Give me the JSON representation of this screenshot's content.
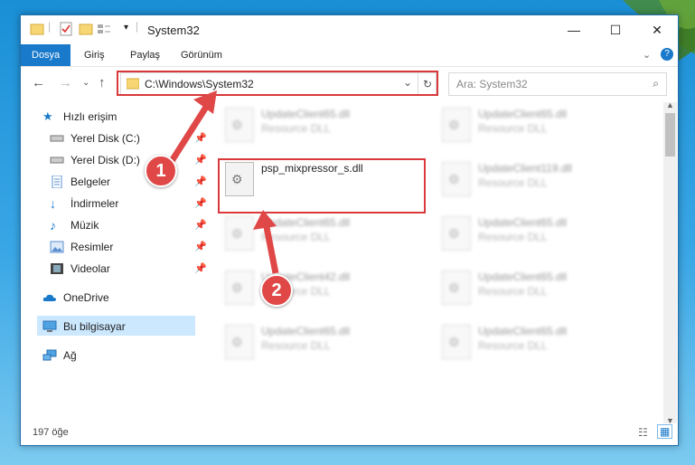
{
  "window": {
    "title": "System32",
    "minimize": "—",
    "maximize": "☐",
    "close": "✕"
  },
  "ribbon": {
    "tabs": [
      "Dosya",
      "Giriş",
      "Paylaş",
      "Görünüm"
    ],
    "expand": "⌄",
    "help": "?"
  },
  "address": {
    "path": "C:\\Windows\\System32",
    "dropdown": "⌄",
    "refresh": "↻"
  },
  "search": {
    "placeholder": "Ara: System32"
  },
  "sidebar": {
    "items": [
      {
        "label": "Hızlı erişim",
        "icon": "star-icon"
      },
      {
        "label": "Yerel Disk (C:)",
        "icon": "drive-icon"
      },
      {
        "label": "Yerel Disk (D:)",
        "icon": "drive-icon"
      },
      {
        "label": "Belgeler",
        "icon": "documents-icon"
      },
      {
        "label": "İndirmeler",
        "icon": "download-icon"
      },
      {
        "label": "Müzik",
        "icon": "music-icon"
      },
      {
        "label": "Resimler",
        "icon": "pictures-icon"
      },
      {
        "label": "Videolar",
        "icon": "videos-icon"
      },
      {
        "label": "OneDrive",
        "icon": "cloud-icon"
      },
      {
        "label": "Bu bilgisayar",
        "icon": "computer-icon"
      },
      {
        "label": "Ağ",
        "icon": "network-icon"
      }
    ]
  },
  "files": [
    {
      "name": "UpdateClient65.dll",
      "type": "Resource DLL"
    },
    {
      "name": "UpdateClient65.dll",
      "type": "Resource DLL"
    },
    {
      "name": "psp_mixpressor_s.dll",
      "type": ""
    },
    {
      "name": "UpdateClient119.dll",
      "type": "Resource DLL"
    },
    {
      "name": "UpdateClient65.dll",
      "type": "Resource DLL"
    },
    {
      "name": "UpdateClient65.dll",
      "type": "Resource DLL"
    },
    {
      "name": "UpdateClient42.dll",
      "type": "Resource DLL"
    },
    {
      "name": "UpdateClient65.dll",
      "type": "Resource DLL"
    },
    {
      "name": "UpdateClient65.dll",
      "type": "Resource DLL"
    },
    {
      "name": "UpdateClient65.dll",
      "type": "Resource DLL"
    }
  ],
  "status": {
    "count": "197 öğe"
  },
  "annotations": {
    "badge1": "1",
    "badge2": "2",
    "color": "#e04848"
  }
}
